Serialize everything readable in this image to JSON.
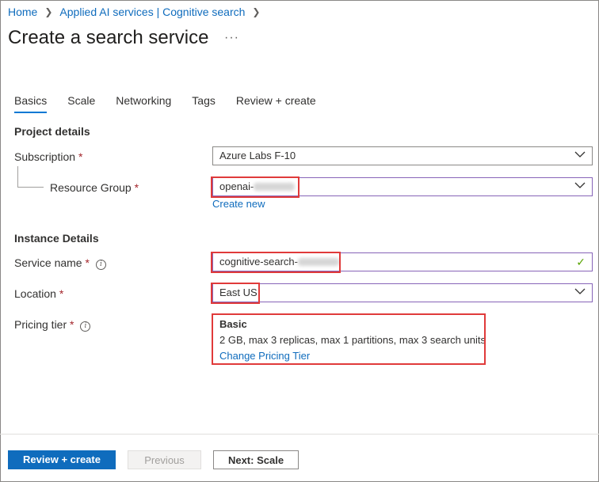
{
  "breadcrumb": {
    "home": "Home",
    "parent": "Applied AI services | Cognitive search"
  },
  "page": {
    "title": "Create a search service",
    "more_label": "···"
  },
  "tabs": [
    {
      "label": "Basics",
      "active": true
    },
    {
      "label": "Scale",
      "active": false
    },
    {
      "label": "Networking",
      "active": false
    },
    {
      "label": "Tags",
      "active": false
    },
    {
      "label": "Review + create",
      "active": false
    }
  ],
  "project_details": {
    "heading": "Project details",
    "subscription": {
      "label": "Subscription",
      "required_mark": "*",
      "value": "Azure Labs F-10"
    },
    "resource_group": {
      "label": "Resource Group",
      "required_mark": "*",
      "value_prefix": "openai-",
      "create_new": "Create new"
    }
  },
  "instance_details": {
    "heading": "Instance Details",
    "service_name": {
      "label": "Service name",
      "required_mark": "*",
      "value_prefix": "cognitive-search-",
      "valid_icon": "checkmark-icon"
    },
    "location": {
      "label": "Location",
      "required_mark": "*",
      "value": "East US"
    },
    "pricing_tier": {
      "label": "Pricing tier",
      "required_mark": "*",
      "tier_name": "Basic",
      "tier_description": "2 GB, max 3 replicas, max 1 partitions, max 3 search units",
      "change_link": "Change Pricing Tier"
    }
  },
  "footer": {
    "review_create": "Review + create",
    "previous": "Previous",
    "next": "Next: Scale"
  },
  "colors": {
    "accent": "#0f6cbd",
    "highlight": "#e03a3a",
    "required": "#a4262c",
    "valid": "#57a300"
  }
}
